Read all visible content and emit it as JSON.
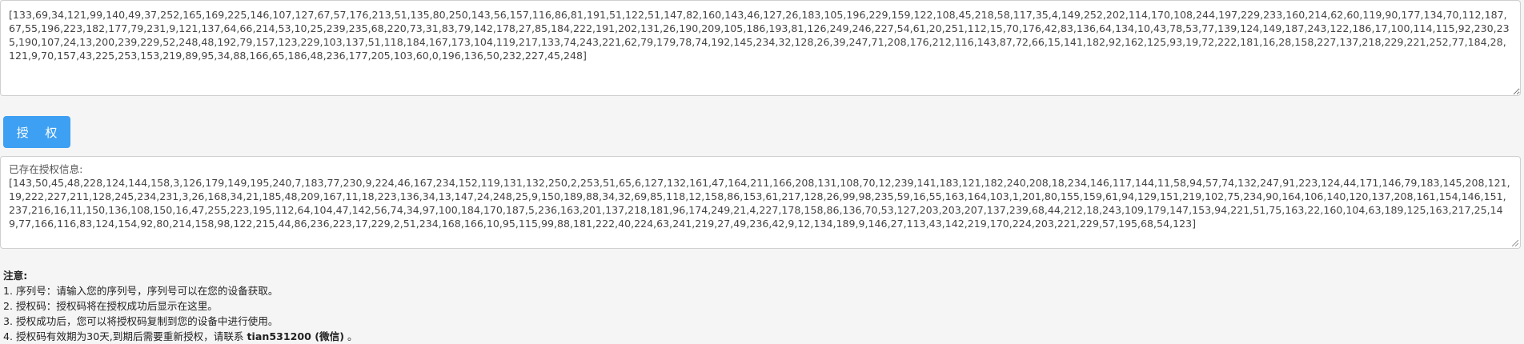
{
  "serial": {
    "value": "[133,69,34,121,99,140,49,37,252,165,169,225,146,107,127,67,57,176,213,51,135,80,250,143,56,157,116,86,81,191,51,122,51,147,82,160,143,46,127,26,183,105,196,229,159,122,108,45,218,58,117,35,4,149,252,202,114,170,108,244,197,229,233,160,214,62,60,119,90,177,134,70,112,187,67,55,196,223,182,177,79,231,9,121,137,64,66,214,53,10,25,239,235,68,220,73,31,83,79,142,178,27,85,184,222,191,202,131,26,190,209,105,186,193,81,126,249,246,227,54,61,20,251,112,15,70,176,42,83,136,64,134,10,43,78,53,77,139,124,149,187,243,122,186,17,100,114,115,92,230,235,190,107,24,13,200,239,229,52,248,48,192,79,157,123,229,103,137,51,118,184,167,173,104,119,217,133,74,243,221,62,79,179,78,74,192,145,234,32,128,26,39,247,71,208,176,212,116,143,87,72,66,15,141,182,92,162,125,93,19,72,222,181,16,28,158,227,137,218,229,221,252,77,184,28,121,9,70,157,43,225,253,153,219,89,95,34,88,166,65,186,48,236,177,205,103,60,0,196,136,50,232,227,45,248]"
  },
  "button": {
    "label": "授 权"
  },
  "auth_info": {
    "label": "已存在授权信息:",
    "value": "[143,50,45,48,228,124,144,158,3,126,179,149,195,240,7,183,77,230,9,224,46,167,234,152,119,131,132,250,2,253,51,65,6,127,132,161,47,164,211,166,208,131,108,70,12,239,141,183,121,182,240,208,18,234,146,117,144,11,58,94,57,74,132,247,91,223,124,44,171,146,79,183,145,208,121,19,222,227,211,128,245,234,231,3,26,168,34,21,185,48,209,167,11,18,223,136,34,13,147,24,248,25,9,150,189,88,34,32,69,85,118,12,158,86,153,61,217,128,26,99,98,235,59,16,55,163,164,103,1,201,80,155,159,61,94,129,151,219,102,75,234,90,164,106,140,120,137,208,161,154,146,151,237,216,16,11,150,136,108,150,16,47,255,223,195,112,64,104,47,142,56,74,34,97,100,184,170,187,5,236,163,201,137,218,181,96,174,249,21,4,227,178,158,86,136,70,53,127,203,203,207,137,239,68,44,212,18,243,109,179,147,153,94,221,51,75,163,22,160,104,63,189,125,163,217,25,149,77,166,116,83,124,154,92,80,214,158,98,122,215,44,86,236,223,17,229,2,51,234,168,166,10,95,115,99,88,181,222,40,224,63,241,219,27,49,236,42,9,12,134,189,9,146,27,113,43,142,219,170,224,203,221,229,57,195,68,54,123]"
  },
  "notes": {
    "title": "注意:",
    "items": [
      "1. 序列号：请输入您的序列号，序列号可以在您的设备获取。",
      "2. 授权码：授权码将在授权成功后显示在这里。",
      "3. 授权成功后，您可以将授权码复制到您的设备中进行使用。"
    ],
    "last_prefix": "4. 授权码有效期为30天,到期后需要重新授权，请联系 ",
    "contact": "tian531200 (微信)",
    "last_suffix": " 。"
  },
  "colors": {
    "button_bg": "#3ea0f3",
    "border": "#cfcfcf",
    "page_bg": "#f5f5f5"
  }
}
